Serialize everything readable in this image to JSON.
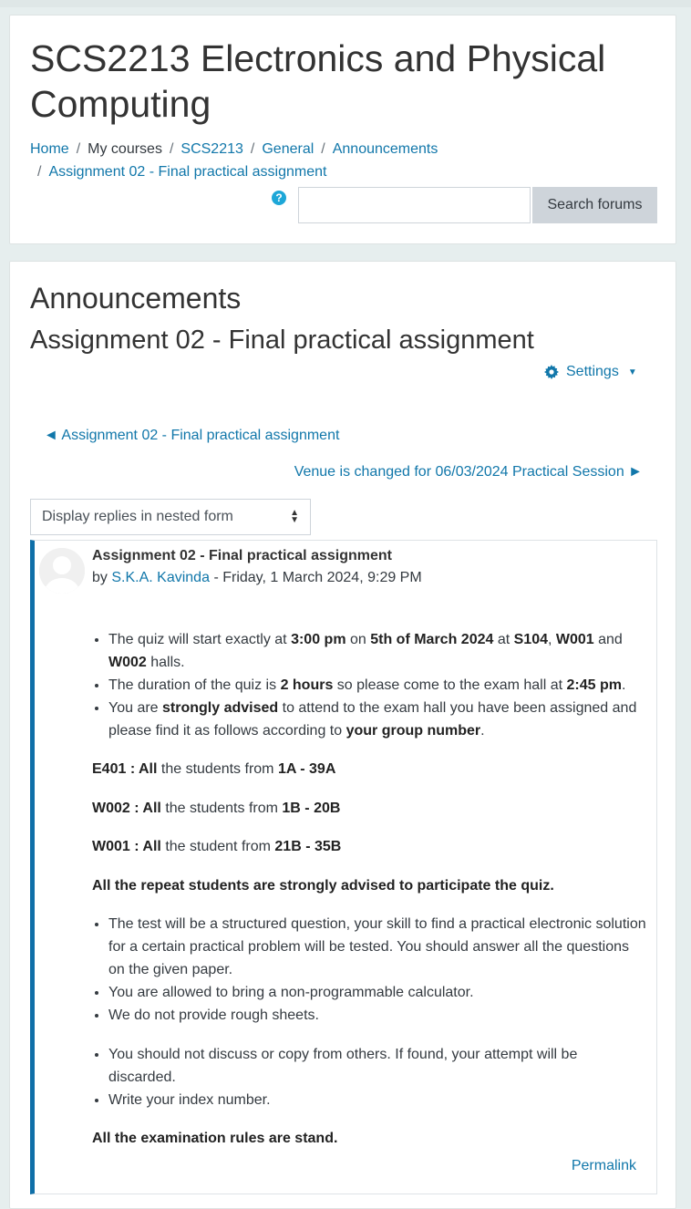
{
  "course": {
    "title": "SCS2213 Electronics and Physical Computing"
  },
  "breadcrumb": {
    "home": "Home",
    "my_courses": "My courses",
    "course_code": "SCS2213",
    "general": "General",
    "announcements": "Announcements",
    "current": "Assignment 02 - Final practical assignment",
    "separator": "/"
  },
  "search": {
    "help_icon": "?",
    "placeholder": "",
    "button_label": "Search forums"
  },
  "forum": {
    "title": "Announcements",
    "discussion_title": "Assignment 02 - Final practical assignment",
    "settings_label": "Settings",
    "prev_discussion": "◄ Assignment 02 - Final practical assignment",
    "next_discussion": "Venue is changed for 06/03/2024 Practical Session ►",
    "display_mode": "Display replies in nested form"
  },
  "post": {
    "subject": "Assignment 02 - Final practical assignment",
    "by": "by",
    "author": "S.K.A. Kavinda",
    "date": "- Friday, 1 March 2024, 9:29 PM",
    "permalink": "Permalink",
    "body": {
      "b1_a": "The quiz will start exactly at ",
      "b1_b": "3:00 pm",
      "b1_c": " on ",
      "b1_d": "5th of March 2024",
      "b1_e": " at ",
      "b1_f": "S104",
      "b1_g": ", ",
      "b1_h": "W001",
      "b1_i": " and ",
      "b1_j": "W002",
      "b1_k": " halls.",
      "b2_a": "The duration of the quiz is ",
      "b2_b": "2 hours",
      "b2_c": " so please come to the exam hall at ",
      "b2_d": "2:45 pm",
      "b2_e": ".",
      "b3_a": "You are ",
      "b3_b": "strongly advised",
      "b3_c": " to attend to the exam hall you have been assigned and please find it as follows according to ",
      "b3_d": "your group number",
      "b3_e": ".",
      "e401_a": "E401 : All",
      "e401_b": " the students from ",
      "e401_c": "1A - 39A",
      "w002_a": "W002 : All",
      "w002_b": " the students from ",
      "w002_c": "1B - 20B",
      "w001_a": "W001 : All",
      "w001_b": " the student from ",
      "w001_c": "21B - 35B",
      "repeat": "All the repeat students are strongly advised to participate the quiz.",
      "b4": "The test will be a structured question, your skill to find a practical electronic solution for a certain practical problem will be tested. You should answer all the questions on the given paper.",
      "b5": "You are allowed to bring a non-programmable calculator.",
      "b6": "We do not provide rough sheets.",
      "b7": "You should not discuss or copy from others. If found, your attempt will be discarded.",
      "b8": "Write your index number.",
      "rules": "All the examination rules are stand."
    }
  }
}
